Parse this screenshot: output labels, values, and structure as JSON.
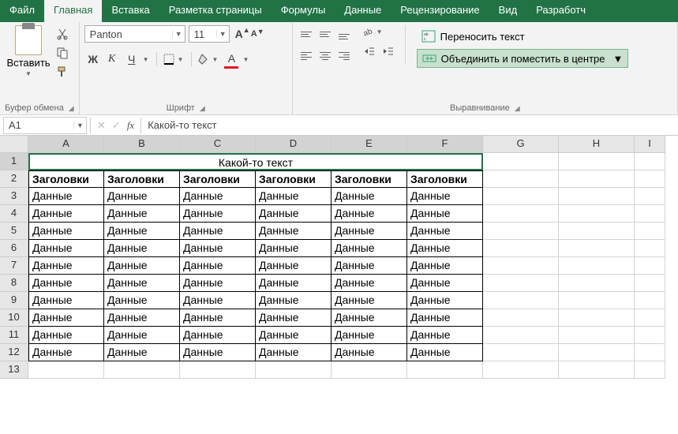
{
  "menu": {
    "items": [
      "Файл",
      "Главная",
      "Вставка",
      "Разметка страницы",
      "Формулы",
      "Данные",
      "Рецензирование",
      "Вид",
      "Разработч"
    ],
    "active": 1
  },
  "ribbon": {
    "clipboard": {
      "paste": "Вставить",
      "label": "Буфер обмена"
    },
    "font": {
      "name": "Panton",
      "size": "11",
      "bold": "Ж",
      "italic": "К",
      "underline": "Ч",
      "label": "Шрифт"
    },
    "align": {
      "wrap": "Переносить текст",
      "merge": "Объединить и поместить в центре",
      "label": "Выравнивание"
    }
  },
  "fbar": {
    "cellref": "A1",
    "fx": "fx",
    "formula": "Какой-то текст"
  },
  "grid": {
    "cols": [
      "A",
      "B",
      "C",
      "D",
      "E",
      "F",
      "G",
      "H",
      "I"
    ],
    "rows": [
      1,
      2,
      3,
      4,
      5,
      6,
      7,
      8,
      9,
      10,
      11,
      12,
      13
    ],
    "title": "Какой-то текст",
    "headers": [
      "Заголовки",
      "Заголовки",
      "Заголовки",
      "Заголовки",
      "Заголовки",
      "Заголовки"
    ],
    "data": [
      [
        "Данные",
        "Данные",
        "Данные",
        "Данные",
        "Данные",
        "Данные"
      ],
      [
        "Данные",
        "Данные",
        "Данные",
        "Данные",
        "Данные",
        "Данные"
      ],
      [
        "Данные",
        "Данные",
        "Данные",
        "Данные",
        "Данные",
        "Данные"
      ],
      [
        "Данные",
        "Данные",
        "Данные",
        "Данные",
        "Данные",
        "Данные"
      ],
      [
        "Данные",
        "Данные",
        "Данные",
        "Данные",
        "Данные",
        "Данные"
      ],
      [
        "Данные",
        "Данные",
        "Данные",
        "Данные",
        "Данные",
        "Данные"
      ],
      [
        "Данные",
        "Данные",
        "Данные",
        "Данные",
        "Данные",
        "Данные"
      ],
      [
        "Данные",
        "Данные",
        "Данные",
        "Данные",
        "Данные",
        "Данные"
      ],
      [
        "Данные",
        "Данные",
        "Данные",
        "Данные",
        "Данные",
        "Данные"
      ],
      [
        "Данные",
        "Данные",
        "Данные",
        "Данные",
        "Данные",
        "Данные"
      ]
    ]
  }
}
